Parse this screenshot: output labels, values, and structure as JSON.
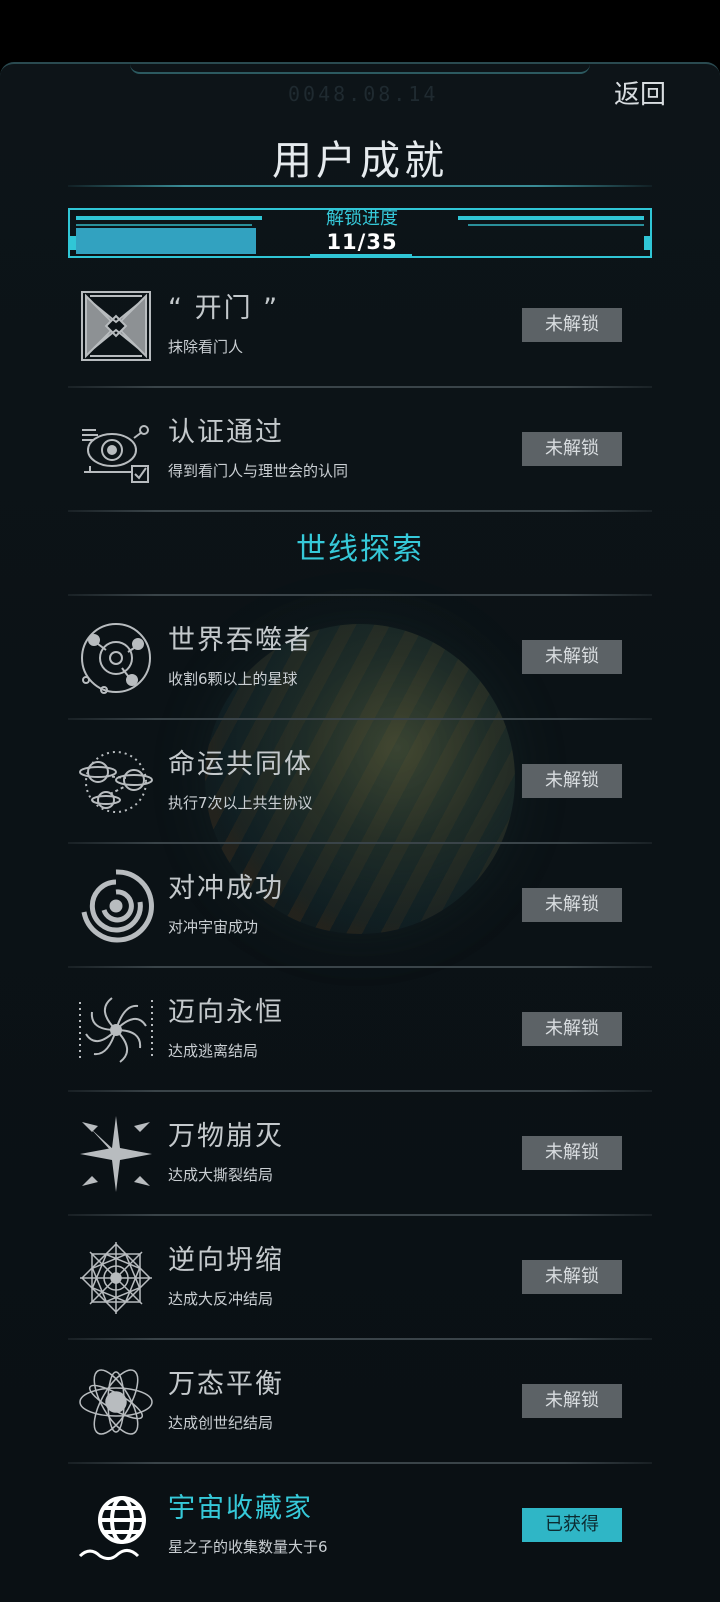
{
  "header": {
    "date": "0048.08.14",
    "back_label": "返回",
    "title": "用户成就"
  },
  "progress": {
    "label": "解锁进度",
    "count": "11/35",
    "fraction": 0.314
  },
  "achievements_top": [
    {
      "name": "“ 开门 ”",
      "desc": "抹除看门人",
      "status": "未解锁",
      "icon": "door-hourglass-icon"
    },
    {
      "name": "认证通过",
      "desc": "得到看门人与理世会的认同",
      "status": "未解锁",
      "icon": "eye-checkbox-icon"
    }
  ],
  "section": {
    "title": "世线探索"
  },
  "achievements": [
    {
      "name": "世界吞噬者",
      "desc": "收割6颗以上的星球",
      "status": "未解锁",
      "icon": "planet-orbit-icon"
    },
    {
      "name": "命运共同体",
      "desc": "执行7次以上共生协议",
      "status": "未解锁",
      "icon": "linked-planets-icon"
    },
    {
      "name": "对冲成功",
      "desc": "对冲宇宙成功",
      "status": "未解锁",
      "icon": "swirl-icon"
    },
    {
      "name": "迈向永恒",
      "desc": "达成逃离结局",
      "status": "未解锁",
      "icon": "vortex-icon"
    },
    {
      "name": "万物崩灭",
      "desc": "达成大撕裂结局",
      "status": "未解锁",
      "icon": "burst-icon"
    },
    {
      "name": "逆向坍缩",
      "desc": "达成大反冲结局",
      "status": "未解锁",
      "icon": "mandala-icon"
    },
    {
      "name": "万态平衡",
      "desc": "达成创世纪结局",
      "status": "未解锁",
      "icon": "atom-icon"
    },
    {
      "name": "宇宙收藏家",
      "desc": "星之子的收集数量大于6",
      "status": "已获得",
      "icon": "globe-collector-icon"
    }
  ]
}
